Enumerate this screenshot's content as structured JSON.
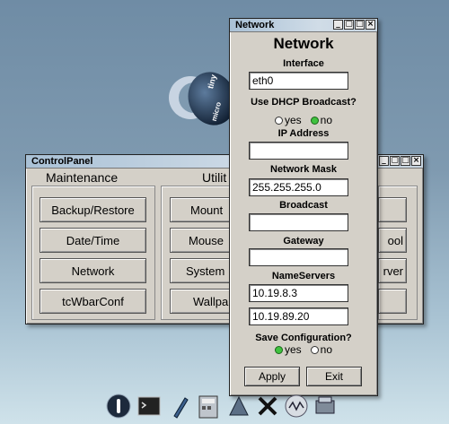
{
  "desktop": {
    "logo_word_1": "tiny",
    "logo_word_2": "micro"
  },
  "control_panel": {
    "title": "ControlPanel",
    "col1_title": "Maintenance",
    "col2_title": "Utilit",
    "maintenance_buttons": [
      "Backup/Restore",
      "Date/Time",
      "Network",
      "tcWbarConf"
    ],
    "utility_buttons": [
      "Mount",
      "Mouse",
      "System",
      "Wallpa"
    ],
    "right_buttons": [
      "ool",
      "rver"
    ]
  },
  "network": {
    "title": "Network",
    "heading": "Network",
    "interface_label": "Interface",
    "interface_value": "eth0",
    "dhcp_label": "Use DHCP Broadcast?",
    "dhcp_yes": "yes",
    "dhcp_no": "no",
    "dhcp_selected": "no",
    "ip_label": "IP Address",
    "ip_value": "",
    "mask_label": "Network Mask",
    "mask_value": "255.255.255.0",
    "broadcast_label": "Broadcast",
    "broadcast_value": "",
    "gateway_label": "Gateway",
    "gateway_value": "",
    "ns_label": "NameServers",
    "ns1_value": "10.19.8.3",
    "ns2_value": "10.19.89.20",
    "save_label": "Save Configuration?",
    "save_yes": "yes",
    "save_no": "no",
    "save_selected": "yes",
    "apply_label": "Apply",
    "exit_label": "Exit"
  },
  "taskbar": {
    "icons": [
      "power-icon",
      "terminal-icon",
      "editor-icon",
      "calculator-icon",
      "mount-icon",
      "tools-icon",
      "network-icon",
      "control-panel-icon"
    ]
  },
  "colors": {
    "window_bg": "#d4d0c8",
    "radio_on": "#3fc23f"
  }
}
